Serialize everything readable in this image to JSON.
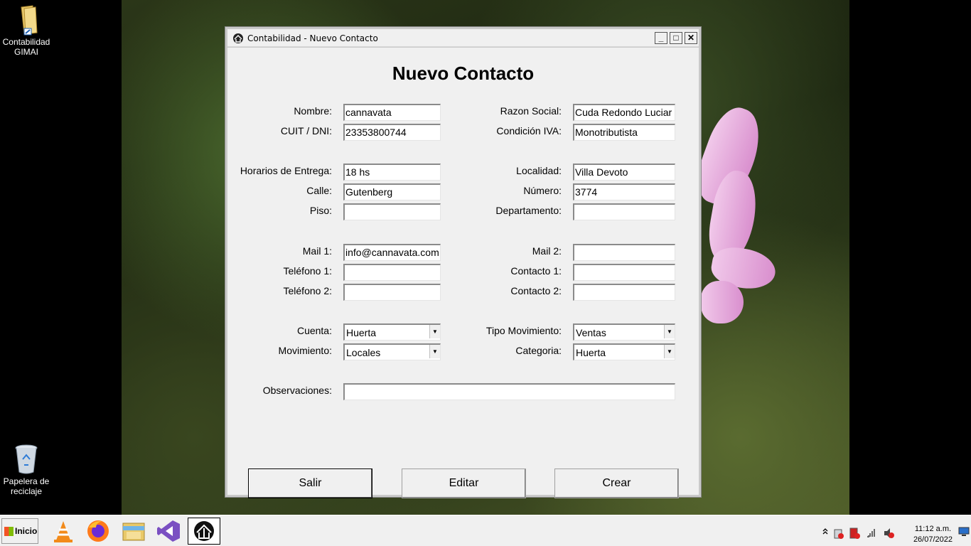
{
  "desktop": {
    "icons": [
      {
        "label": "Contabilidad GIMAI",
        "icon": "folder-icon"
      },
      {
        "label": "Papelera de reciclaje",
        "icon": "recycle-bin-icon"
      }
    ]
  },
  "window": {
    "title": "Contabilidad - Nuevo Contacto",
    "controls": {
      "minimize": "_",
      "maximize": "□",
      "close": "✕"
    },
    "heading": "Nuevo Contacto"
  },
  "form": {
    "nombre": {
      "label": "Nombre:",
      "value": "cannavata"
    },
    "cuit": {
      "label": "CUIT / DNI:",
      "value": "23353800744"
    },
    "razon_social": {
      "label": "Razon Social:",
      "value": "Cuda Redondo Luciar"
    },
    "condicion_iva": {
      "label": "Condición IVA:",
      "value": "Monotributista"
    },
    "horarios": {
      "label": "Horarios de Entrega:",
      "value": "18 hs"
    },
    "calle": {
      "label": "Calle:",
      "value": "Gutenberg"
    },
    "piso": {
      "label": "Piso:",
      "value": ""
    },
    "localidad": {
      "label": "Localidad:",
      "value": "Villa Devoto"
    },
    "numero": {
      "label": "Número:",
      "value": "3774"
    },
    "departamento": {
      "label": "Departamento:",
      "value": ""
    },
    "mail1": {
      "label": "Mail 1:",
      "value": "info@cannavata.com"
    },
    "telefono1": {
      "label": "Teléfono 1:",
      "value": ""
    },
    "telefono2": {
      "label": "Teléfono 2:",
      "value": ""
    },
    "mail2": {
      "label": "Mail 2:",
      "value": ""
    },
    "contacto1": {
      "label": "Contacto 1:",
      "value": ""
    },
    "contacto2": {
      "label": "Contacto 2:",
      "value": ""
    },
    "cuenta": {
      "label": "Cuenta:",
      "value": "Huerta"
    },
    "movimiento": {
      "label": "Movimiento:",
      "value": "Locales"
    },
    "tipo_movimiento": {
      "label": "Tipo Movimiento:",
      "value": "Ventas"
    },
    "categoria": {
      "label": "Categoria:",
      "value": "Huerta"
    },
    "observaciones": {
      "label": "Observaciones:",
      "value": ""
    }
  },
  "buttons": {
    "salir": "Salir",
    "editar": "Editar",
    "crear": "Crear"
  },
  "taskbar": {
    "start_label": "Inicio",
    "apps": [
      "vlc-icon",
      "firefox-icon",
      "file-explorer-icon",
      "visual-studio-icon",
      "contabilidad-app-icon"
    ],
    "time": "11:12 a.m.",
    "date": "26/07/2022"
  }
}
